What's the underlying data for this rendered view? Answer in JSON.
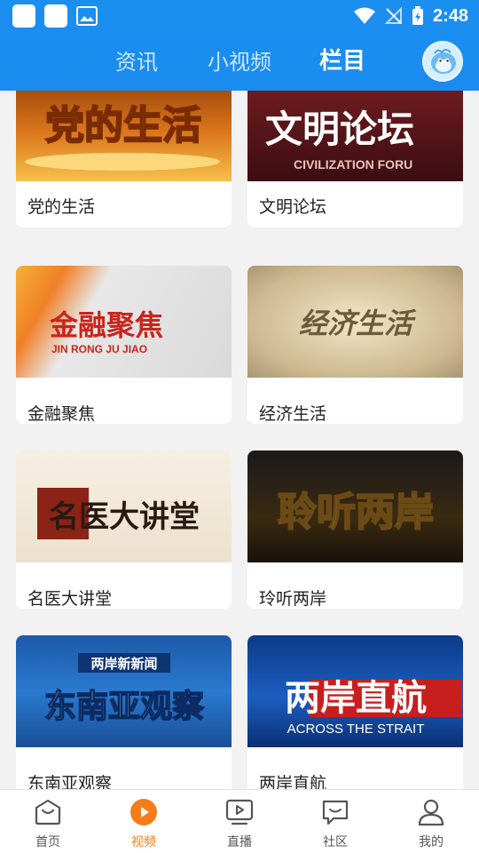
{
  "status_bar": {
    "time": "2:48"
  },
  "header": {
    "tabs": [
      {
        "label": "资讯"
      },
      {
        "label": "小视频"
      },
      {
        "label": "栏目"
      }
    ]
  },
  "programs": [
    {
      "title": "党的生活",
      "banner": "党的生活",
      "banner_sub": ""
    },
    {
      "title": "文明论坛",
      "banner": "文明论坛",
      "banner_sub": "CIVILIZATION FORU"
    },
    {
      "title": "金融聚焦",
      "banner": "金融聚焦",
      "banner_sub": "JIN RONG JU JIAO"
    },
    {
      "title": "经济生活",
      "banner": "经济生活",
      "banner_sub": ""
    },
    {
      "title": "名医大讲堂",
      "banner": "名医大讲堂",
      "banner_sub": ""
    },
    {
      "title": "玲听两岸",
      "banner": "聆听两岸",
      "banner_sub": ""
    },
    {
      "title": "东南亚观察",
      "banner": "东南亚观察",
      "banner_sub": "两岸新新闻"
    },
    {
      "title": "两岸直航",
      "banner": "两岸直航",
      "banner_sub": "ACROSS THE STRAIT"
    }
  ],
  "bottom_nav": [
    {
      "label": "首页",
      "icon": "home-icon"
    },
    {
      "label": "视频",
      "icon": "video-play-icon"
    },
    {
      "label": "直播",
      "icon": "live-tv-icon"
    },
    {
      "label": "社区",
      "icon": "community-chat-icon"
    },
    {
      "label": "我的",
      "icon": "profile-icon"
    }
  ],
  "colors": {
    "header_blue": "#1a8cef",
    "accent_orange": "#f47d19"
  }
}
